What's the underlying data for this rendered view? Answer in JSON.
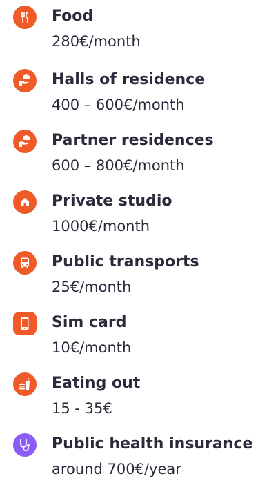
{
  "accent_color": "#f05a28",
  "items": [
    {
      "icon": "fork-knife-icon",
      "title": "Food",
      "value": "280€/month"
    },
    {
      "icon": "hand-house-icon",
      "title": "Halls of residence",
      "value": "400 – 600€/month"
    },
    {
      "icon": "hand-house-icon",
      "title": "Partner residences",
      "value": "600 – 800€/month"
    },
    {
      "icon": "home-icon",
      "title": "Private studio",
      "value": "1000€/month"
    },
    {
      "icon": "bus-icon",
      "title": "Public transports",
      "value": "25€/month"
    },
    {
      "icon": "phone-icon",
      "title": "Sim card",
      "value": "10€/month"
    },
    {
      "icon": "fast-food-icon",
      "title": "Eating out",
      "value": "15 - 35€"
    },
    {
      "icon": "stethoscope-icon",
      "title": "Public health insurance",
      "value": "around 700€/year"
    }
  ]
}
